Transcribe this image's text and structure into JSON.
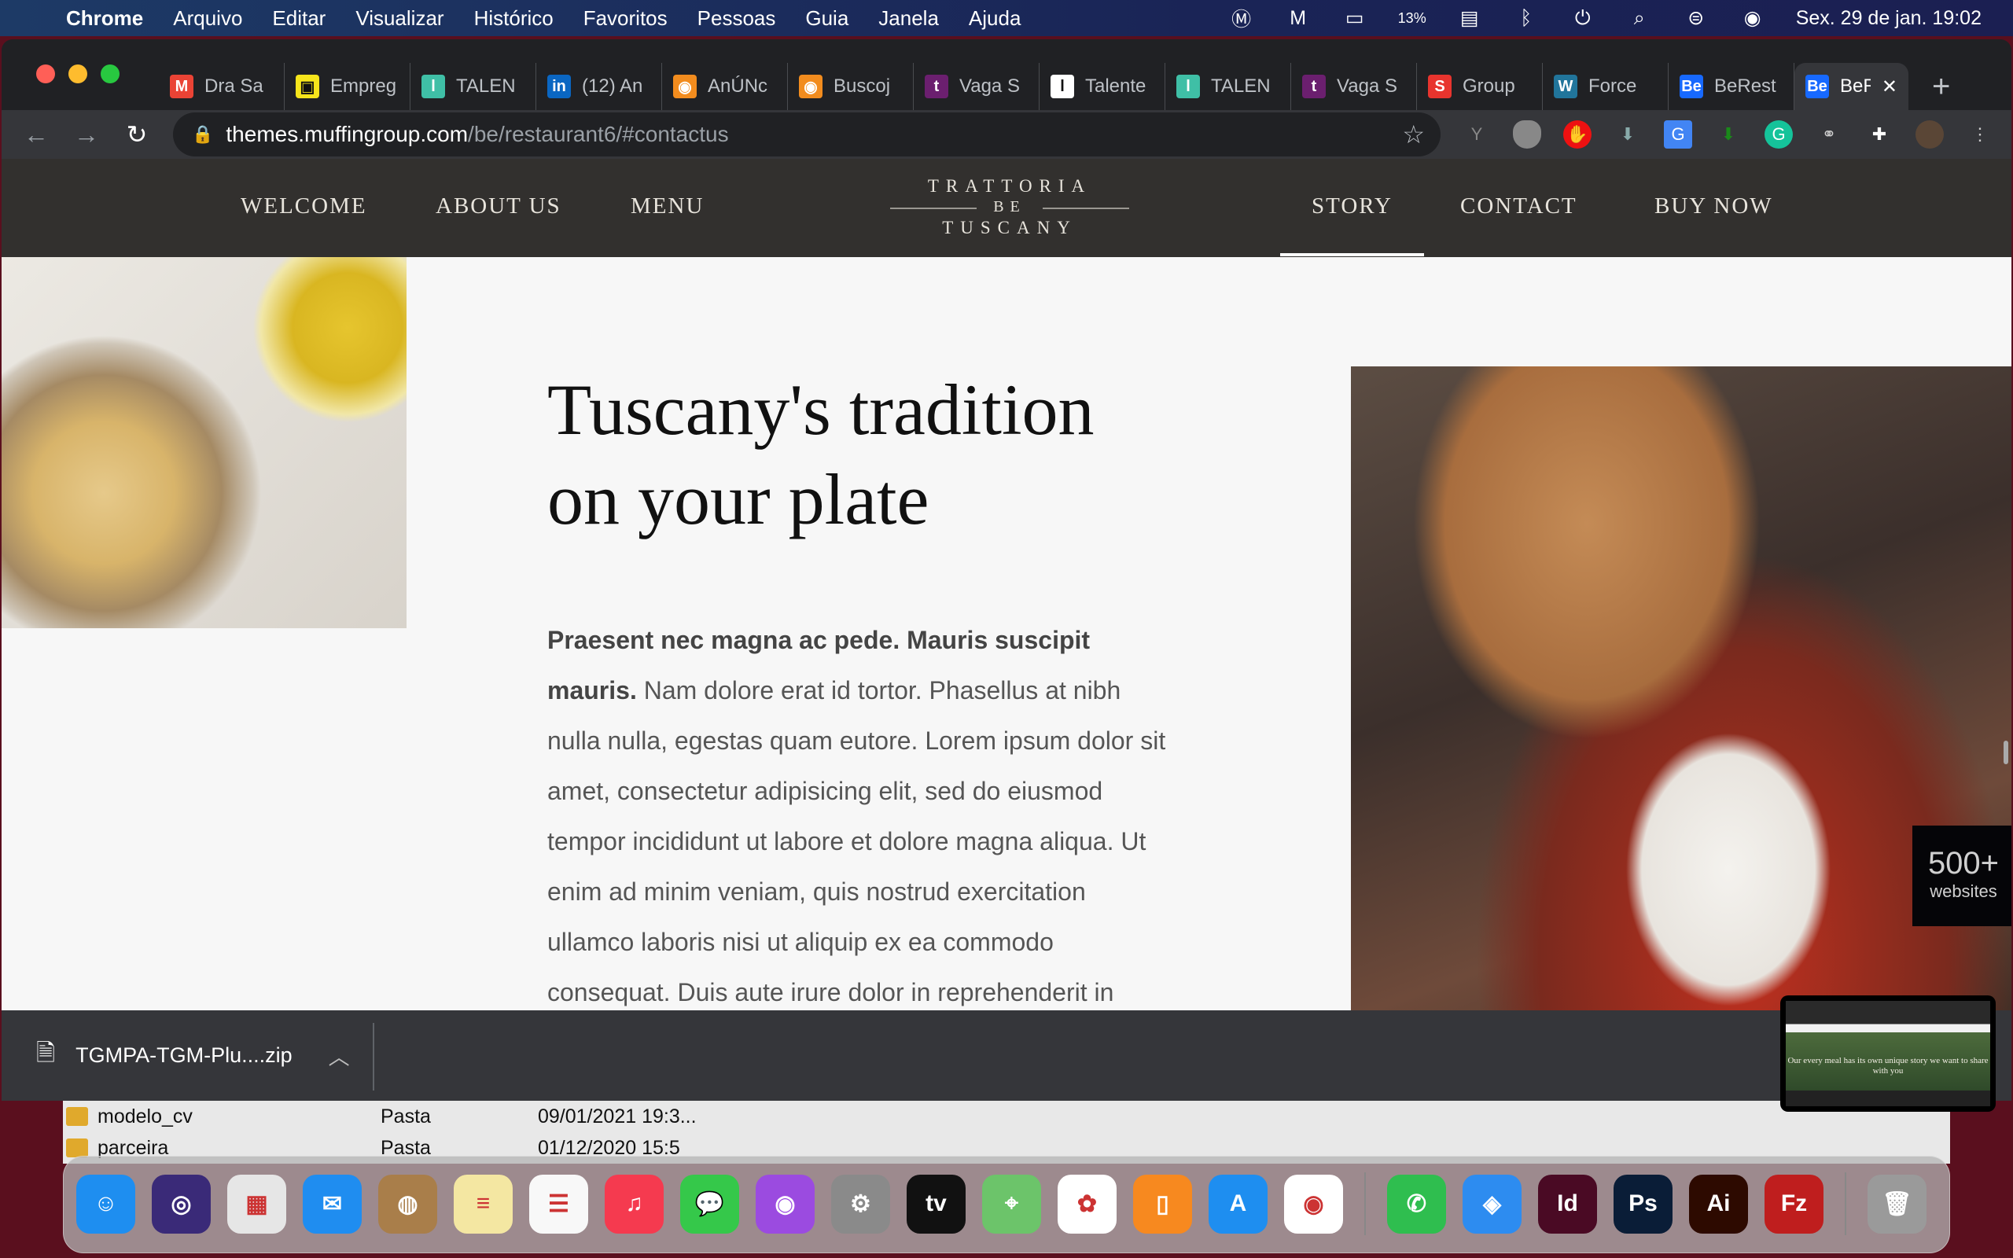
{
  "menubar": {
    "app": "Chrome",
    "items": [
      "Arquivo",
      "Editar",
      "Visualizar",
      "Histórico",
      "Favoritos",
      "Pessoas",
      "Guia",
      "Janela",
      "Ajuda"
    ],
    "battery": "13%",
    "clock": "Sex. 29 de jan.  19:02"
  },
  "browser": {
    "tabs": [
      {
        "label": "Dra Sa",
        "icon": "gmail-icon",
        "color": "#ea4335",
        "glyph": "M"
      },
      {
        "label": "Empreg",
        "icon": "briefcase-icon",
        "color": "#f6e51b",
        "glyph": "▣"
      },
      {
        "label": "TALEN",
        "icon": "talent-icon",
        "color": "#3fbfa6",
        "glyph": "l"
      },
      {
        "label": "(12) An",
        "icon": "linkedin-icon",
        "color": "#0a66c2",
        "glyph": "in"
      },
      {
        "label": "AnÚNc",
        "icon": "ring-icon",
        "color": "#f28c1e",
        "glyph": "◉"
      },
      {
        "label": "Buscoj",
        "icon": "ring-icon",
        "color": "#f28c1e",
        "glyph": "◉"
      },
      {
        "label": "Vaga S",
        "icon": "t-icon",
        "color": "#6b1f6f",
        "glyph": "t"
      },
      {
        "label": "Talente",
        "icon": "talent-icon",
        "color": "#ffffff",
        "glyph": "l"
      },
      {
        "label": "TALEN",
        "icon": "talent-icon",
        "color": "#3fbfa6",
        "glyph": "l"
      },
      {
        "label": "Vaga S",
        "icon": "t-icon",
        "color": "#6b1f6f",
        "glyph": "t"
      },
      {
        "label": "Group",
        "icon": "group-icon",
        "color": "#e8342e",
        "glyph": "S"
      },
      {
        "label": "Force",
        "icon": "wordpress-icon",
        "color": "#21759b",
        "glyph": "W"
      },
      {
        "label": "BeRest",
        "icon": "behance-icon",
        "color": "#1769ff",
        "glyph": "Be"
      },
      {
        "label": "BeR",
        "icon": "behance-icon",
        "color": "#1769ff",
        "glyph": "Be",
        "active": true
      }
    ],
    "url_host": "themes.muffingroup.com",
    "url_path": "/be/restaurant6/#contactus"
  },
  "site": {
    "nav_left": [
      "WELCOME",
      "ABOUT US",
      "MENU"
    ],
    "nav_right": [
      "STORY",
      "CONTACT",
      "BUY NOW"
    ],
    "active_nav": "STORY",
    "logo": {
      "line1": "TRATTORIA",
      "line2": "BE",
      "line3": "TUSCANY"
    },
    "heading_line1": "Tuscany's tradition",
    "heading_line2": "on your plate",
    "para_bold": "Praesent nec magna ac pede. Mauris suscipit mauris.",
    "para_text": " Nam dolore erat id tortor. Phasellus at nibh nulla nulla, egestas quam eutore. Lorem ipsum dolor sit amet, consectetur adipisicing elit, sed do eiusmod tempor incididunt ut labore et dolore magna aliqua. Ut enim ad minim veniam, quis nostrud exercitation ullamco laboris nisi ut aliquip ex ea commodo consequat. Duis aute irure dolor in reprehenderit in voluptate velit esse",
    "badge_number": "500+",
    "badge_label": "websites"
  },
  "download": {
    "filename": "TGMPA-TGM-Plu....zip"
  },
  "finder": [
    {
      "name": "modelo_cv",
      "kind": "Pasta",
      "date": "09/01/2021 19:3..."
    },
    {
      "name": "parceira",
      "kind": "Pasta",
      "date": "01/12/2020 15:5"
    }
  ],
  "preview": {
    "caption": "Our every meal has its own unique story we want to share with you"
  },
  "dock": [
    {
      "name": "finder",
      "color": "#1e8ef0",
      "glyph": "☺"
    },
    {
      "name": "siri",
      "color": "#3a2a78",
      "glyph": "◎"
    },
    {
      "name": "launchpad",
      "color": "#e6e6e6",
      "glyph": "▦"
    },
    {
      "name": "mail",
      "color": "#1f8df0",
      "glyph": "✉"
    },
    {
      "name": "contacts",
      "color": "#a97e4a",
      "glyph": "◍"
    },
    {
      "name": "notes",
      "color": "#f4e7a2",
      "glyph": "≡"
    },
    {
      "name": "reminders",
      "color": "#f8f8f8",
      "glyph": "☰"
    },
    {
      "name": "music",
      "color": "#f53a4f",
      "glyph": "♫"
    },
    {
      "name": "messages",
      "color": "#35c84a",
      "glyph": "💬"
    },
    {
      "name": "podcasts",
      "color": "#9b4be0",
      "glyph": "◉"
    },
    {
      "name": "system-preferences",
      "color": "#8a8a8a",
      "glyph": "⚙"
    },
    {
      "name": "apple-tv",
      "color": "#111111",
      "glyph": "tv"
    },
    {
      "name": "maps",
      "color": "#6cc46a",
      "glyph": "⌖"
    },
    {
      "name": "photos",
      "color": "#ffffff",
      "glyph": "✿"
    },
    {
      "name": "books",
      "color": "#f7891f",
      "glyph": "▯"
    },
    {
      "name": "app-store",
      "color": "#1e8ef0",
      "glyph": "A"
    },
    {
      "name": "chrome",
      "color": "#ffffff",
      "glyph": "◉"
    },
    {
      "sep": true
    },
    {
      "name": "whatsapp",
      "color": "#2fbe4f",
      "glyph": "✆"
    },
    {
      "name": "safari",
      "color": "#2d8cf0",
      "glyph": "◈"
    },
    {
      "name": "indesign",
      "color": "#4a0a24",
      "glyph": "Id"
    },
    {
      "name": "photoshop",
      "color": "#0a1d37",
      "glyph": "Ps"
    },
    {
      "name": "illustrator",
      "color": "#2d0a00",
      "glyph": "Ai"
    },
    {
      "name": "filezilla",
      "color": "#bf1e1e",
      "glyph": "Fz"
    },
    {
      "sep": true
    },
    {
      "name": "trash",
      "color": "#9a9a9a",
      "glyph": "🗑"
    }
  ]
}
